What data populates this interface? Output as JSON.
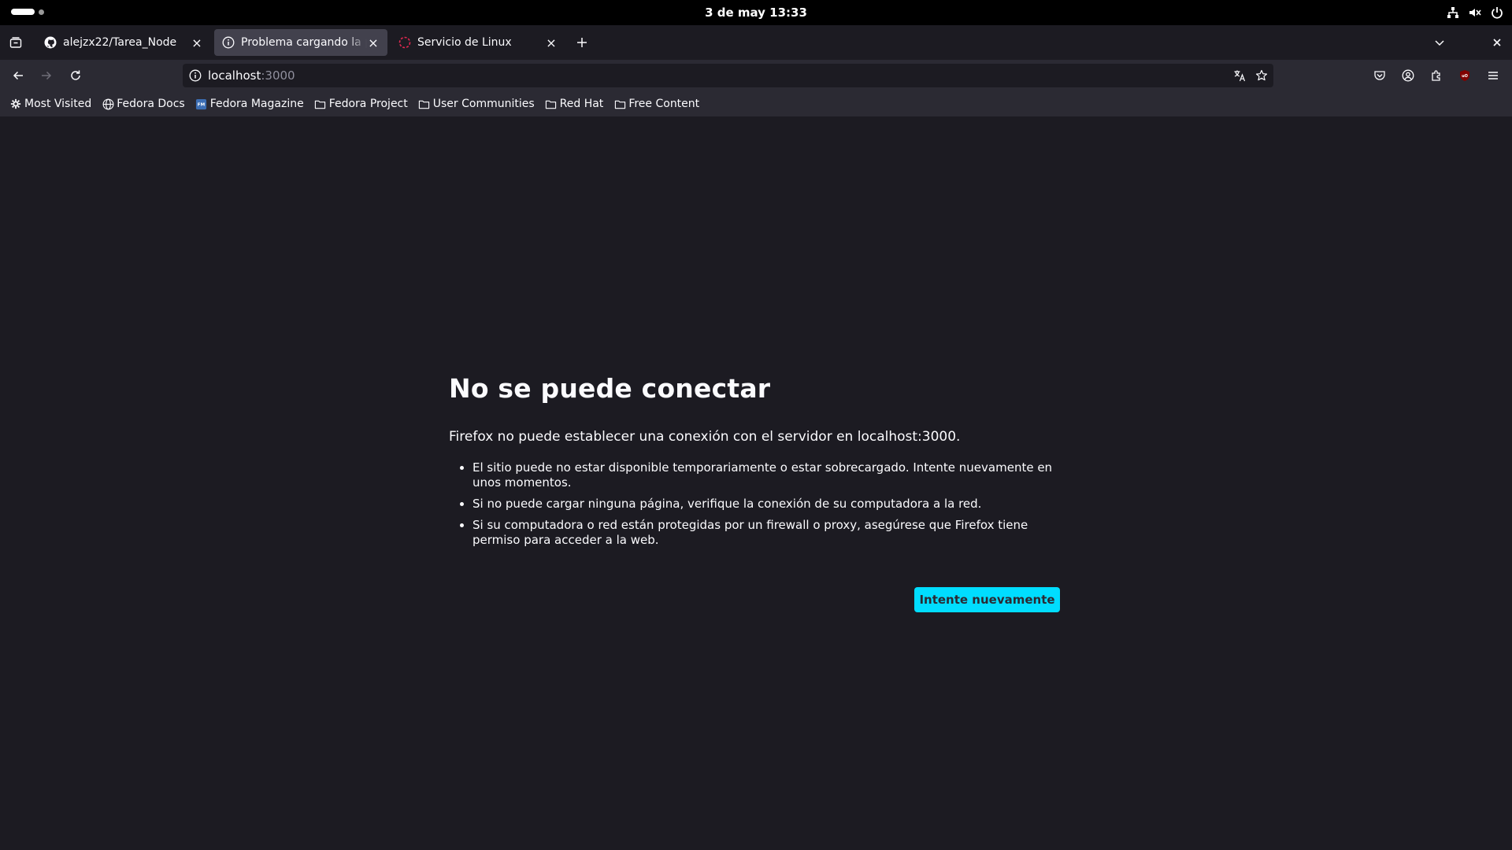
{
  "system": {
    "clock": "3 de may  13:33"
  },
  "tabs": [
    {
      "title": "alejzx22/Tarea_Node",
      "icon": "github-icon"
    },
    {
      "title": "Problema cargando la página",
      "icon": "info-icon"
    },
    {
      "title": "Servicio de Linux",
      "icon": "loading-icon"
    }
  ],
  "urlbar": {
    "host": "localhost",
    "port": ":3000"
  },
  "bookmarks": [
    {
      "label": "Most Visited",
      "icon": "gear-icon"
    },
    {
      "label": "Fedora Docs",
      "icon": "globe-icon"
    },
    {
      "label": "Fedora Magazine",
      "icon": "fedora-magazine-icon"
    },
    {
      "label": "Fedora Project",
      "icon": "folder-icon"
    },
    {
      "label": "User Communities",
      "icon": "folder-icon"
    },
    {
      "label": "Red Hat",
      "icon": "folder-icon"
    },
    {
      "label": "Free Content",
      "icon": "folder-icon"
    }
  ],
  "error": {
    "title": "No se puede conectar",
    "description": "Firefox no puede establecer una conexión con el servidor en localhost:3000.",
    "items": [
      "El sitio puede no estar disponible temporariamente o estar sobrecargado. Intente nuevamente en unos momentos.",
      "Si no puede cargar ninguna página, verifique la conexión de su computadora a la red.",
      "Si su computadora o red están protegidas por un firewall o proxy, asegúrese que Firefox tiene permiso para acceder a la web."
    ],
    "retry_label": "Intente nuevamente"
  },
  "colors": {
    "accent": "#00ddff",
    "background": "#1c1b22",
    "toolbar": "#2b2a33",
    "selected_tab": "#42414d"
  }
}
